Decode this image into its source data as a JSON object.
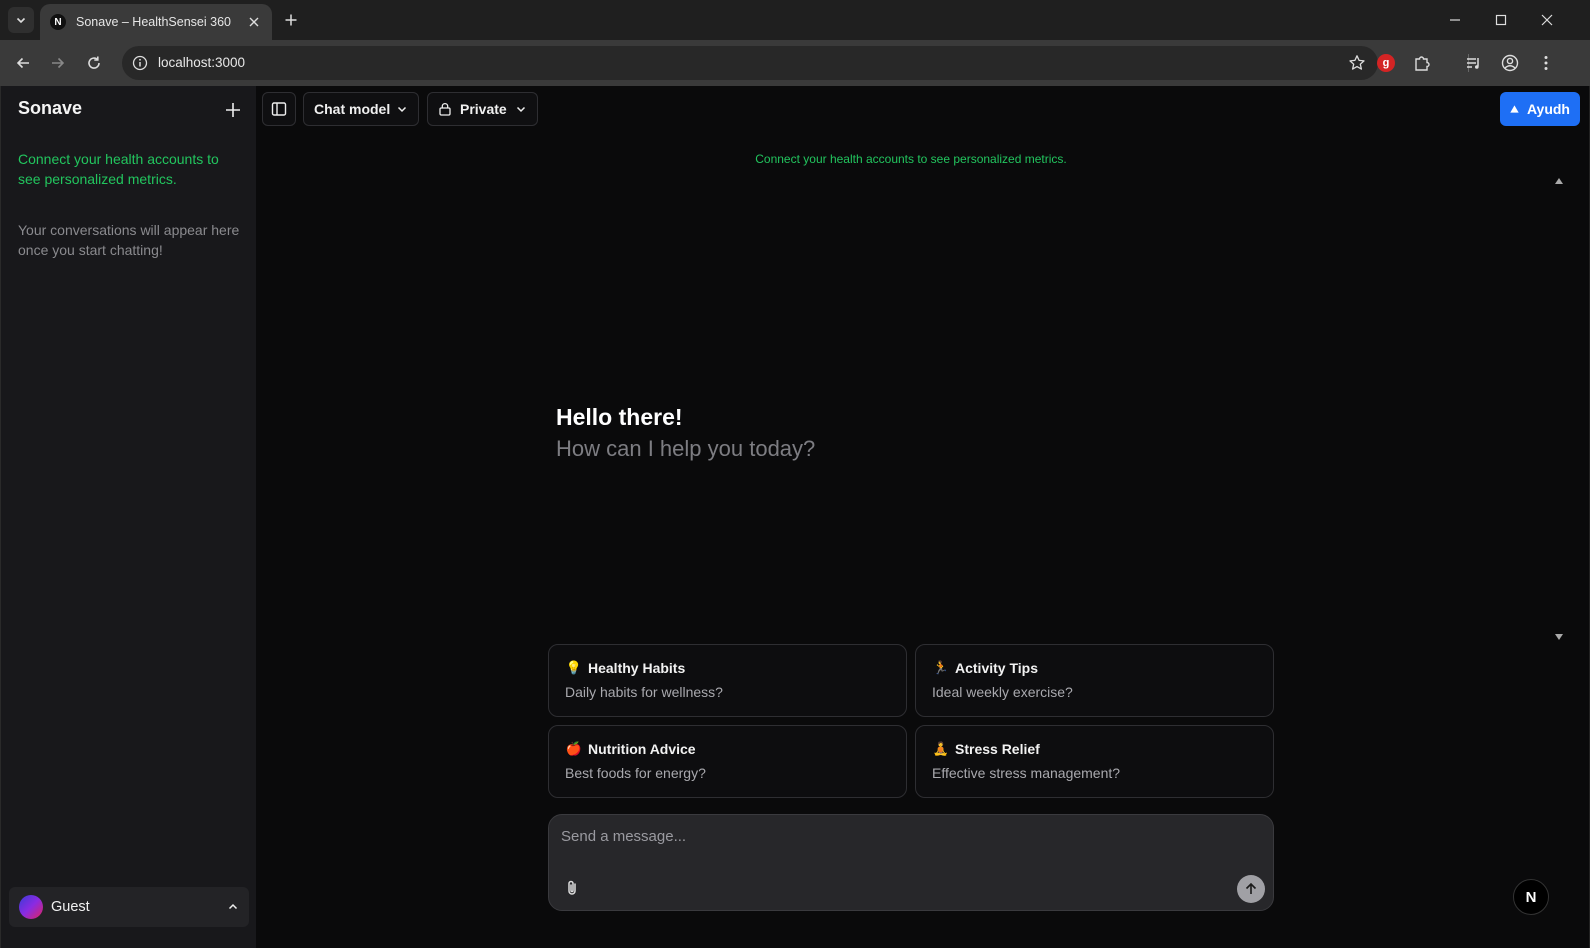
{
  "browser": {
    "tab_title": "Sonave – HealthSensei 360",
    "favicon_letter": "N",
    "url": "localhost:3000",
    "extension_letter": "g"
  },
  "sidebar": {
    "brand": "Sonave",
    "connect_text": "Connect your health accounts to see personalized metrics.",
    "empty_text": "Your conversations will appear here once you start chatting!",
    "user_name": "Guest"
  },
  "header": {
    "model_label": "Chat model",
    "visibility_label": "Private",
    "account_label": "Ayudh"
  },
  "main": {
    "connect_text": "Connect your health accounts to see personalized metrics.",
    "greeting": "Hello there!",
    "subgreeting": "How can I help you today?"
  },
  "suggestions": [
    {
      "emoji": "💡",
      "title": "Healthy Habits",
      "subtitle": "Daily habits for wellness?"
    },
    {
      "emoji": "🏃",
      "title": "Activity Tips",
      "subtitle": "Ideal weekly exercise?"
    },
    {
      "emoji": "🍎",
      "title": "Nutrition Advice",
      "subtitle": "Best foods for energy?"
    },
    {
      "emoji": "🧘",
      "title": "Stress Relief",
      "subtitle": "Effective stress management?"
    }
  ],
  "composer": {
    "placeholder": "Send a message..."
  },
  "badge": {
    "letter": "N"
  }
}
